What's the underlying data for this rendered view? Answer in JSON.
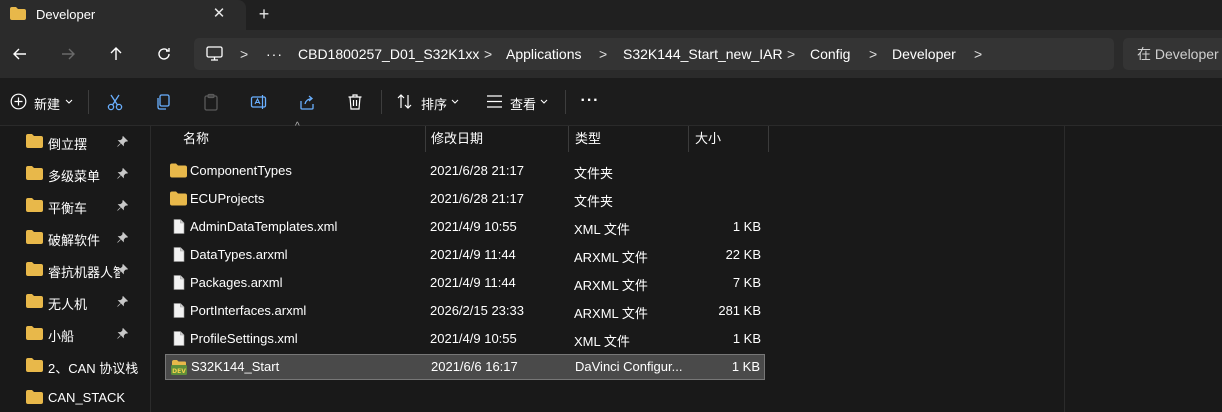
{
  "window": {
    "tab_title": "Developer",
    "close_symbol": "✕",
    "new_tab_symbol": "+"
  },
  "address_bar": {
    "overflow_label": "···",
    "separator": ">",
    "breadcrumbs": [
      "CBD1800257_D01_S32K1xx",
      "Applications",
      "S32K144_Start_new_IAR",
      "Config",
      "Developer"
    ],
    "search_placeholder": "在 Developer 中搜索"
  },
  "toolbar": {
    "new_label": "新建",
    "sort_label": "排序",
    "view_label": "查看",
    "more_label": "···"
  },
  "sidebar": {
    "items": [
      {
        "label": "倒立摆",
        "pinned": true
      },
      {
        "label": "多级菜单",
        "pinned": true
      },
      {
        "label": "平衡车",
        "pinned": true
      },
      {
        "label": "破解软件",
        "pinned": true
      },
      {
        "label": "睿抗机器人智",
        "pinned": true
      },
      {
        "label": "无人机",
        "pinned": true
      },
      {
        "label": "小船",
        "pinned": true
      },
      {
        "label": "2、CAN 协议栈",
        "pinned": false
      },
      {
        "label": "CAN_STACK",
        "pinned": false
      }
    ]
  },
  "file_list": {
    "columns": {
      "name": "名称",
      "date": "修改日期",
      "type": "类型",
      "size": "大小"
    },
    "rows": [
      {
        "name": "ComponentTypes",
        "date": "2021/6/28 21:17",
        "type": "文件夹",
        "size": "",
        "icon": "folder-icon"
      },
      {
        "name": "ECUProjects",
        "date": "2021/6/28 21:17",
        "type": "文件夹",
        "size": "",
        "icon": "folder-icon"
      },
      {
        "name": "AdminDataTemplates.xml",
        "date": "2021/4/9 10:55",
        "type": "XML 文件",
        "size": "1 KB",
        "icon": "file-icon"
      },
      {
        "name": "DataTypes.arxml",
        "date": "2021/4/9 11:44",
        "type": "ARXML 文件",
        "size": "22 KB",
        "icon": "file-icon"
      },
      {
        "name": "Packages.arxml",
        "date": "2021/4/9 11:44",
        "type": "ARXML 文件",
        "size": "7 KB",
        "icon": "file-icon"
      },
      {
        "name": "PortInterfaces.arxml",
        "date": "2026/2/15 23:33",
        "type": "ARXML 文件",
        "size": "281 KB",
        "icon": "file-icon"
      },
      {
        "name": "ProfileSettings.xml",
        "date": "2021/4/9 10:55",
        "type": "XML 文件",
        "size": "1 KB",
        "icon": "file-icon"
      },
      {
        "name": "S32K144_Start",
        "date": "2021/6/6 16:17",
        "type": "DaVinci Configur...",
        "size": "1 KB",
        "icon": "davinci-dev-icon",
        "selected": true
      }
    ]
  },
  "colors": {
    "folder": "#e8b84a",
    "selected_row": "#4a4a4a",
    "background": "#191919"
  }
}
